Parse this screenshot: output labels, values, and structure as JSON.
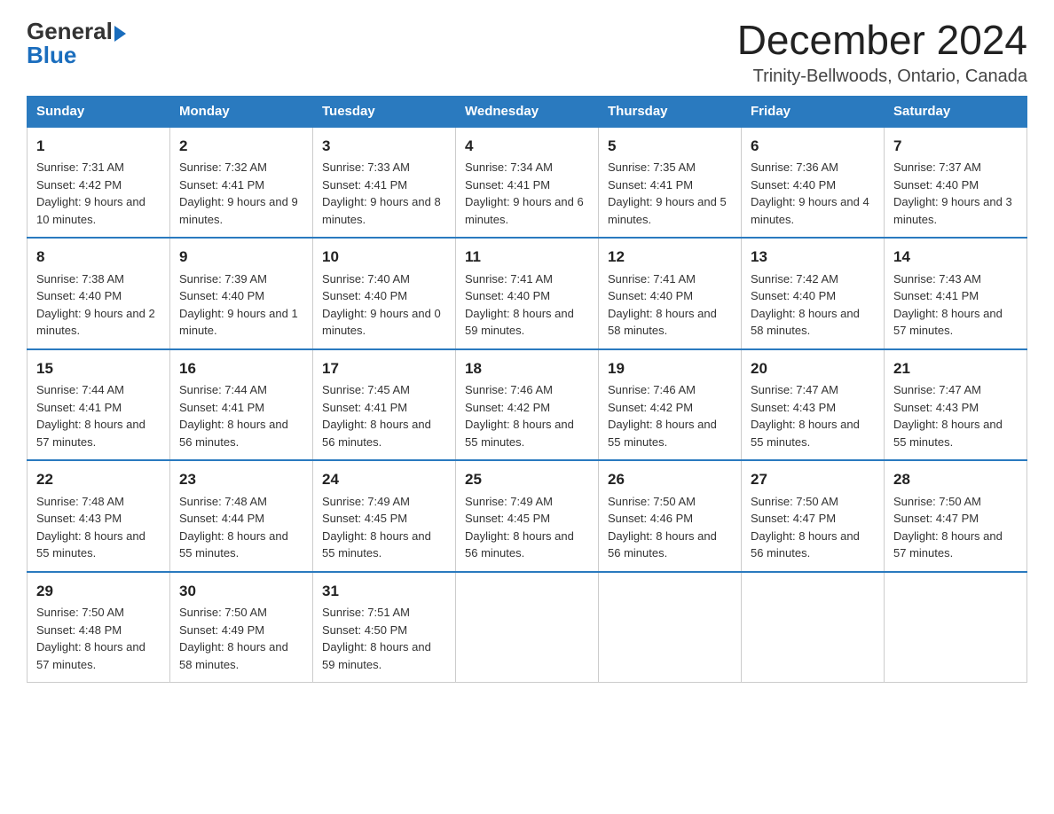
{
  "logo": {
    "text_general": "General",
    "text_blue": "Blue",
    "arrow": "▶"
  },
  "header": {
    "month_year": "December 2024",
    "location": "Trinity-Bellwoods, Ontario, Canada"
  },
  "weekdays": [
    "Sunday",
    "Monday",
    "Tuesday",
    "Wednesday",
    "Thursday",
    "Friday",
    "Saturday"
  ],
  "weeks": [
    [
      {
        "day": "1",
        "sunrise": "7:31 AM",
        "sunset": "4:42 PM",
        "daylight": "9 hours and 10 minutes."
      },
      {
        "day": "2",
        "sunrise": "7:32 AM",
        "sunset": "4:41 PM",
        "daylight": "9 hours and 9 minutes."
      },
      {
        "day": "3",
        "sunrise": "7:33 AM",
        "sunset": "4:41 PM",
        "daylight": "9 hours and 8 minutes."
      },
      {
        "day": "4",
        "sunrise": "7:34 AM",
        "sunset": "4:41 PM",
        "daylight": "9 hours and 6 minutes."
      },
      {
        "day": "5",
        "sunrise": "7:35 AM",
        "sunset": "4:41 PM",
        "daylight": "9 hours and 5 minutes."
      },
      {
        "day": "6",
        "sunrise": "7:36 AM",
        "sunset": "4:40 PM",
        "daylight": "9 hours and 4 minutes."
      },
      {
        "day": "7",
        "sunrise": "7:37 AM",
        "sunset": "4:40 PM",
        "daylight": "9 hours and 3 minutes."
      }
    ],
    [
      {
        "day": "8",
        "sunrise": "7:38 AM",
        "sunset": "4:40 PM",
        "daylight": "9 hours and 2 minutes."
      },
      {
        "day": "9",
        "sunrise": "7:39 AM",
        "sunset": "4:40 PM",
        "daylight": "9 hours and 1 minute."
      },
      {
        "day": "10",
        "sunrise": "7:40 AM",
        "sunset": "4:40 PM",
        "daylight": "9 hours and 0 minutes."
      },
      {
        "day": "11",
        "sunrise": "7:41 AM",
        "sunset": "4:40 PM",
        "daylight": "8 hours and 59 minutes."
      },
      {
        "day": "12",
        "sunrise": "7:41 AM",
        "sunset": "4:40 PM",
        "daylight": "8 hours and 58 minutes."
      },
      {
        "day": "13",
        "sunrise": "7:42 AM",
        "sunset": "4:40 PM",
        "daylight": "8 hours and 58 minutes."
      },
      {
        "day": "14",
        "sunrise": "7:43 AM",
        "sunset": "4:41 PM",
        "daylight": "8 hours and 57 minutes."
      }
    ],
    [
      {
        "day": "15",
        "sunrise": "7:44 AM",
        "sunset": "4:41 PM",
        "daylight": "8 hours and 57 minutes."
      },
      {
        "day": "16",
        "sunrise": "7:44 AM",
        "sunset": "4:41 PM",
        "daylight": "8 hours and 56 minutes."
      },
      {
        "day": "17",
        "sunrise": "7:45 AM",
        "sunset": "4:41 PM",
        "daylight": "8 hours and 56 minutes."
      },
      {
        "day": "18",
        "sunrise": "7:46 AM",
        "sunset": "4:42 PM",
        "daylight": "8 hours and 55 minutes."
      },
      {
        "day": "19",
        "sunrise": "7:46 AM",
        "sunset": "4:42 PM",
        "daylight": "8 hours and 55 minutes."
      },
      {
        "day": "20",
        "sunrise": "7:47 AM",
        "sunset": "4:43 PM",
        "daylight": "8 hours and 55 minutes."
      },
      {
        "day": "21",
        "sunrise": "7:47 AM",
        "sunset": "4:43 PM",
        "daylight": "8 hours and 55 minutes."
      }
    ],
    [
      {
        "day": "22",
        "sunrise": "7:48 AM",
        "sunset": "4:43 PM",
        "daylight": "8 hours and 55 minutes."
      },
      {
        "day": "23",
        "sunrise": "7:48 AM",
        "sunset": "4:44 PM",
        "daylight": "8 hours and 55 minutes."
      },
      {
        "day": "24",
        "sunrise": "7:49 AM",
        "sunset": "4:45 PM",
        "daylight": "8 hours and 55 minutes."
      },
      {
        "day": "25",
        "sunrise": "7:49 AM",
        "sunset": "4:45 PM",
        "daylight": "8 hours and 56 minutes."
      },
      {
        "day": "26",
        "sunrise": "7:50 AM",
        "sunset": "4:46 PM",
        "daylight": "8 hours and 56 minutes."
      },
      {
        "day": "27",
        "sunrise": "7:50 AM",
        "sunset": "4:47 PM",
        "daylight": "8 hours and 56 minutes."
      },
      {
        "day": "28",
        "sunrise": "7:50 AM",
        "sunset": "4:47 PM",
        "daylight": "8 hours and 57 minutes."
      }
    ],
    [
      {
        "day": "29",
        "sunrise": "7:50 AM",
        "sunset": "4:48 PM",
        "daylight": "8 hours and 57 minutes."
      },
      {
        "day": "30",
        "sunrise": "7:50 AM",
        "sunset": "4:49 PM",
        "daylight": "8 hours and 58 minutes."
      },
      {
        "day": "31",
        "sunrise": "7:51 AM",
        "sunset": "4:50 PM",
        "daylight": "8 hours and 59 minutes."
      },
      null,
      null,
      null,
      null
    ]
  ],
  "labels": {
    "sunrise": "Sunrise:",
    "sunset": "Sunset:",
    "daylight": "Daylight:"
  }
}
